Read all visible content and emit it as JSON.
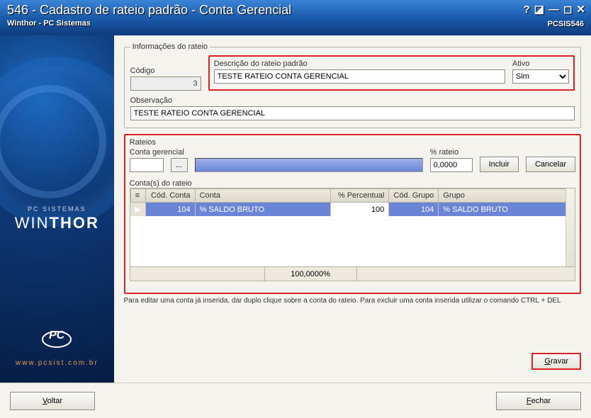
{
  "window": {
    "title": "546 - Cadastro de rateio padrão - Conta Gerencial",
    "subtitle": "Winthor - PC Sistemas",
    "code": "PCSIS546"
  },
  "brand": {
    "small": "PC SISTEMAS",
    "name_part1": "WIN",
    "name_part2": "THOR",
    "url": "www.pcsist.com.br"
  },
  "info_group": {
    "legend": "Informações do rateio",
    "codigo_label": "Código",
    "codigo_value": "3",
    "descricao_label": "Descrição do rateio padrão",
    "descricao_value": "TESTE RATEIO CONTA GERENCIAL",
    "ativo_label": "Ativo",
    "ativo_value": "Sim",
    "observacao_label": "Observação",
    "observacao_value": "TESTE RATEIO CONTA GERENCIAL"
  },
  "rateios": {
    "legend": "Rateios",
    "conta_gerencial_label": "Conta gerencial",
    "conta_gerencial_value": "",
    "perc_rateio_label": "% rateio",
    "perc_rateio_value": "0,0000",
    "btn_incluir": "Incluir",
    "btn_cancelar": "Cancelar"
  },
  "grid": {
    "legend": "Conta(s) do rateio",
    "headers": {
      "ind": "≡",
      "cod_conta": "Cód. Conta",
      "conta": "Conta",
      "perc": "% Percentual",
      "cod_grupo": "Cód. Grupo",
      "grupo": "Grupo"
    },
    "rows": [
      {
        "cod_conta": "104",
        "conta": "% SALDO BRUTO",
        "perc": "100",
        "cod_grupo": "104",
        "grupo": "% SALDO BRUTO"
      }
    ],
    "footer_perc": "100,0000%"
  },
  "hint": "Para editar uma conta já inserida, dar duplo clique sobre a conta do rateio. Para excluir uma conta inserida utilizar o comando CTRL + DEL",
  "buttons": {
    "gravar": "Gravar",
    "voltar": "Voltar",
    "fechar": "Fechar"
  }
}
